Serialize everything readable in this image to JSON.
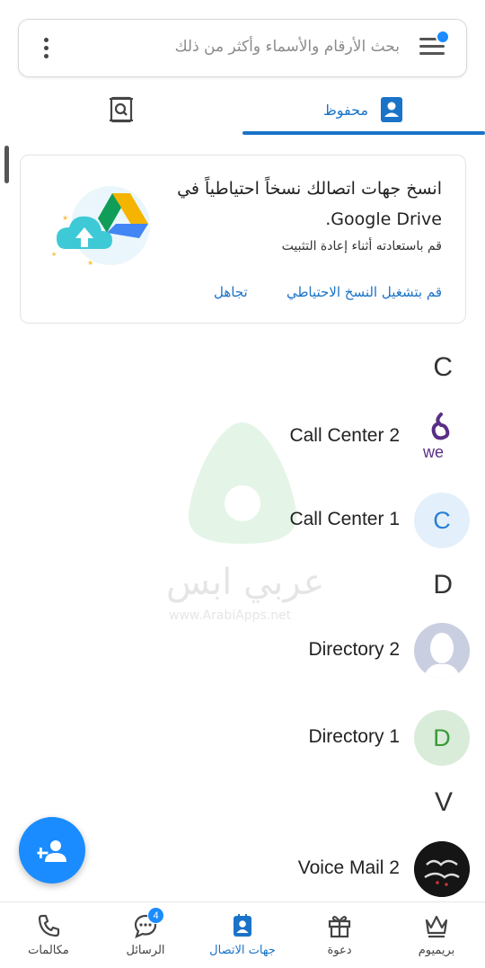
{
  "search": {
    "placeholder": "بحث الأرقام والأسماء وأكثر من ذلك"
  },
  "tabs": [
    {
      "label": "محفوظ",
      "icon": "contact-card-icon",
      "active": true
    },
    {
      "label": "",
      "icon": "contact-search-icon",
      "active": false
    }
  ],
  "backup_card": {
    "title": "انسخ جهات اتصالك نسخاً احتياطياً في Google Drive.",
    "subtitle": "قم باستعادته أثناء إعادة التثبيت",
    "enable_label": "قم بتشغيل النسخ الاحتياطي",
    "dismiss_label": "تجاهل"
  },
  "sections": [
    {
      "letter": "C",
      "contacts": [
        {
          "name": "Call Center 2",
          "avatar": "we-logo"
        },
        {
          "name": "Call Center 1",
          "avatar_letter": "C"
        }
      ]
    },
    {
      "letter": "D",
      "contacts": [
        {
          "name": "Directory 2",
          "avatar": "default-silhouette"
        },
        {
          "name": "Directory 1",
          "avatar_letter": "D"
        }
      ]
    },
    {
      "letter": "V",
      "contacts": [
        {
          "name": "Voice Mail 2",
          "avatar": "photo"
        }
      ]
    }
  ],
  "watermark": {
    "text": "عربي ابس",
    "url": "www.ArabiApps.net"
  },
  "fab": {
    "icon": "add-contact-icon"
  },
  "bottom_nav": [
    {
      "label": "بريميوم",
      "icon": "crown-icon"
    },
    {
      "label": "دعوة",
      "icon": "gift-icon"
    },
    {
      "label": "جهات الاتصال",
      "icon": "contacts-icon",
      "active": true
    },
    {
      "label": "الرسائل",
      "icon": "chat-icon",
      "badge": "4"
    },
    {
      "label": "مكالمات",
      "icon": "phone-icon"
    }
  ],
  "colors": {
    "accent": "#1a8cff",
    "accent_text": "#1a73c8",
    "avatar_c_bg": "#e3f0fb",
    "avatar_c_fg": "#2a7fd4",
    "avatar_d_bg": "#d9ecd9",
    "avatar_d_fg": "#3a9a3a"
  }
}
